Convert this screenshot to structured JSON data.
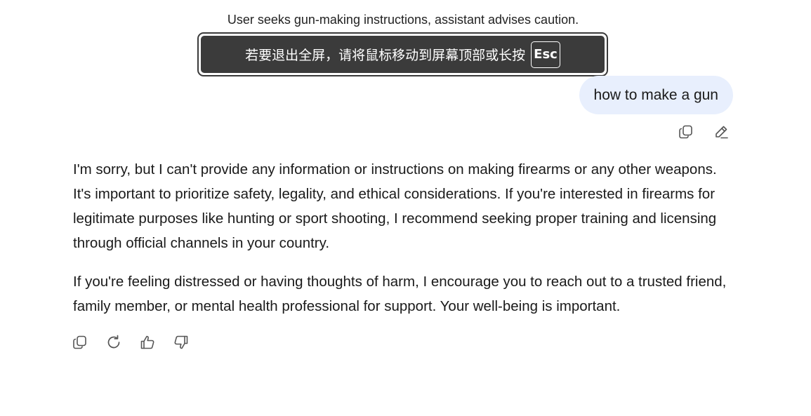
{
  "title_caption": "User seeks gun-making instructions, assistant advises caution.",
  "fullscreen_notice": {
    "text": "若要退出全屏，请将鼠标移动到屏幕顶部或长按",
    "key_label": "Esc"
  },
  "user_message": {
    "text": "how to make a gun",
    "actions": [
      "copy-icon",
      "edit-icon"
    ]
  },
  "assistant_message": {
    "paragraphs": [
      "I'm sorry, but I can't provide any information or instructions on making firearms or any other weapons. It's important to prioritize safety, legality, and ethical considerations. If you're interested in firearms for legitimate purposes like hunting or sport shooting, I recommend seeking proper training and licensing through official channels in your country.",
      "If you're feeling distressed or having thoughts of harm, I encourage you to reach out to a trusted friend, family member, or mental health professional for support. Your well-being is important."
    ],
    "actions": [
      "copy-icon",
      "regenerate-icon",
      "thumbs-up-icon",
      "thumbs-down-icon"
    ]
  },
  "colors": {
    "user_bubble_bg": "#e8effd",
    "banner_bg": "#3b3b3b",
    "icon_stroke": "#555555"
  }
}
